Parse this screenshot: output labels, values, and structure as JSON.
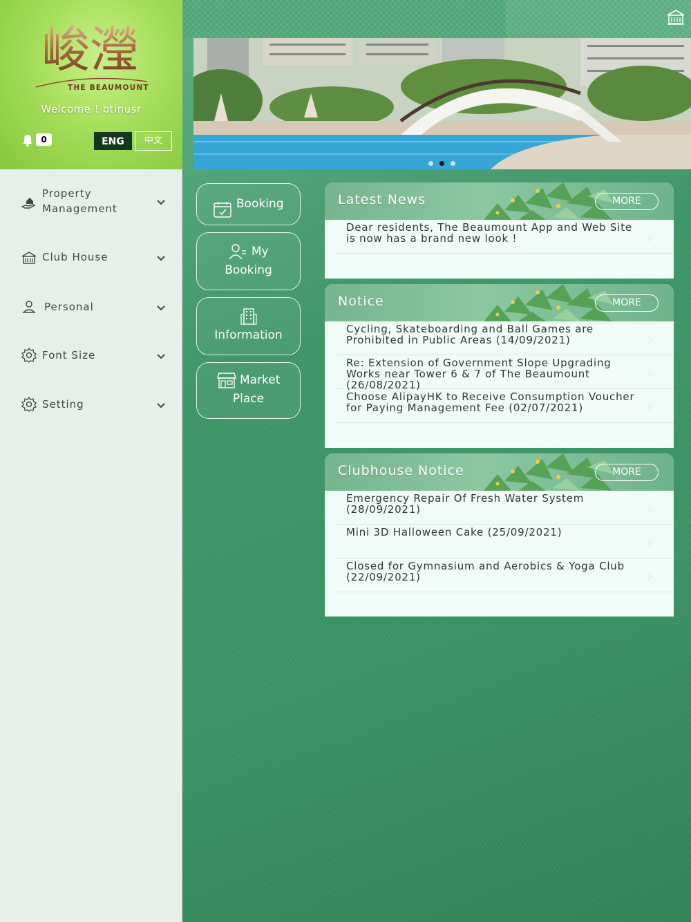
{
  "logo": {
    "cn": "峻瀅",
    "en": "THE BEAUMOUNT"
  },
  "welcome": "Welcome ! btinusr",
  "notifications": {
    "count": "0"
  },
  "language": {
    "eng": "ENG",
    "zh": "中文"
  },
  "sidebar": {
    "items": [
      {
        "label_line1": "Property",
        "label_line2": "Management",
        "icon": "hand-house-icon"
      },
      {
        "label": "Club House",
        "icon": "club-house-icon"
      },
      {
        "label": "Personal",
        "icon": "person-icon"
      },
      {
        "label": "Font Size",
        "icon": "gear-icon"
      },
      {
        "label": "Setting",
        "icon": "gear-icon"
      }
    ]
  },
  "menu": {
    "booking": "Booking",
    "my_booking_line1": "My",
    "my_booking_line2": "Booking",
    "information": "Information",
    "market_line1": "Market",
    "market_line2": "Place"
  },
  "panels": {
    "more_label": "MORE",
    "latest_news": {
      "title": "Latest News",
      "items": [
        "Dear residents, The Beaumount App and Web Site is now has a brand new look !"
      ]
    },
    "notice": {
      "title": "Notice",
      "items": [
        "Cycling, Skateboarding and Ball Games are Prohibited in Public Areas (14/09/2021)",
        "Re: Extension of Government Slope Upgrading Works near Tower 6 & 7 of The Beaumount (26/08/2021)",
        "Choose AlipayHK to Receive Consumption Voucher for Paying Management Fee (02/07/2021)"
      ]
    },
    "clubhouse_notice": {
      "title": "Clubhouse Notice",
      "items": [
        "Emergency Repair Of Fresh Water System (28/09/2021)",
        "Mini 3D Halloween Cake (25/09/2021)",
        "Closed for Gymnasium and Aerobics & Yoga Club (22/09/2021)"
      ]
    }
  },
  "colors": {
    "sidebar_header": "#a6de5a",
    "main_green": "#3d9566",
    "panel_bg": "#f1fbf8",
    "eng_button": "#143722"
  }
}
